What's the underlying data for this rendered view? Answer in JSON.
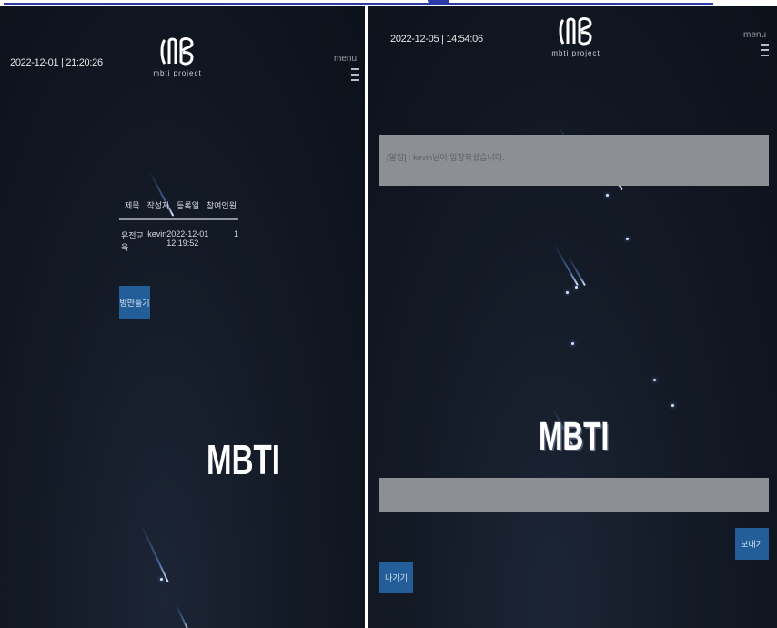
{
  "left_screen": {
    "datetime": "2022-12-01 | 21:20:26",
    "menu_label": "menu",
    "logo_tagline": "mbti project",
    "table": {
      "headers": [
        "제목",
        "작성자",
        "등록일",
        "참여인원"
      ],
      "rows": [
        [
          "유전교육",
          "kevin",
          "2022-12-01 12:19:52",
          "1"
        ]
      ]
    },
    "create_room_button": "방만들기",
    "brand_text": "MBTI"
  },
  "right_screen": {
    "datetime": "2022-12-05 | 14:54:06",
    "menu_label": "menu",
    "logo_tagline": "mbti project",
    "notice": "[알림] : kevin님이 입장하셨습니다.",
    "brand_text": "MBTI",
    "message_input_value": "",
    "send_button": "보내기",
    "exit_button": "나가기"
  },
  "colors": {
    "background": "#111824",
    "button": "#245e99",
    "notice_box": "#8c9094",
    "text": "#e6e6e6"
  }
}
